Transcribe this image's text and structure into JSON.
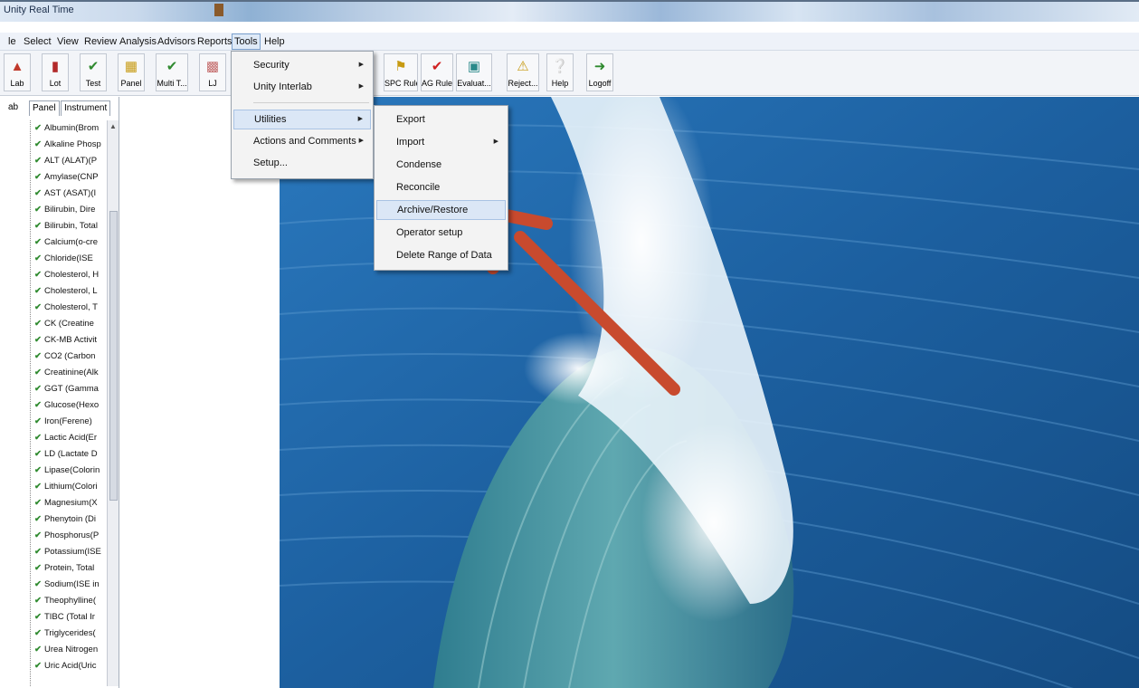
{
  "window": {
    "title": "Unity Real Time"
  },
  "menubar": [
    "le",
    "Select",
    "View",
    "Review",
    "Analysis",
    "Advisors",
    "Reports",
    "Tools",
    "Help"
  ],
  "toolbar": {
    "left": [
      "Lab",
      "Lot",
      "Test",
      "Panel",
      "Multi T...",
      "LJ"
    ],
    "right": [
      "SPC Rules",
      "AG Rules",
      "Evaluat...",
      "Reject...",
      "Help",
      "Logoff"
    ]
  },
  "tree": {
    "tabs": [
      "ab",
      "Panel",
      "Instrument"
    ],
    "items": [
      "Albumin(Brom",
      "Alkaline Phosp",
      "ALT (ALAT)(P",
      "Amylase(CNP",
      "AST (ASAT)(I",
      "Bilirubin, Dire",
      "Bilirubin, Total",
      "Calcium(o-cre",
      "Chloride(ISE ",
      "Cholesterol, H",
      "Cholesterol, L",
      "Cholesterol, T",
      "CK (Creatine",
      "CK-MB Activit",
      "CO2 (Carbon",
      "Creatinine(Alk",
      "GGT (Gamma",
      "Glucose(Hexo",
      "Iron(Ferene)",
      "Lactic Acid(Er",
      "LD (Lactate D",
      "Lipase(Colorin",
      "Lithium(Colori",
      "Magnesium(X",
      "Phenytoin (Di",
      "Phosphorus(P",
      "Potassium(ISE",
      "Protein, Total",
      "Sodium(ISE in",
      "Theophylline(",
      "TIBC (Total Ir",
      "Triglycerides(",
      "Urea Nitrogen",
      "Uric Acid(Uric"
    ]
  },
  "tools_menu": {
    "items": [
      {
        "label": "Security",
        "submenu": true
      },
      {
        "label": "Unity Interlab",
        "submenu": true
      },
      {
        "label": "Utilities",
        "submenu": true
      },
      {
        "label": "Actions and Comments",
        "submenu": true
      },
      {
        "label": "Setup...",
        "submenu": false
      }
    ]
  },
  "utilities_menu": {
    "items": [
      {
        "label": "Export",
        "submenu": false
      },
      {
        "label": "Import",
        "submenu": true
      },
      {
        "label": "Condense",
        "submenu": false
      },
      {
        "label": "Reconcile",
        "submenu": false
      },
      {
        "label": "Archive/Restore",
        "submenu": false
      },
      {
        "label": "Operator setup",
        "submenu": false
      },
      {
        "label": "Delete Range of Data",
        "submenu": false
      }
    ]
  },
  "icons": {
    "submenu_arrow": "triangle-right-icon",
    "tree_item": "analyte-check-icon",
    "annotation": "red-arrow-annotation"
  },
  "colors": {
    "annotation_arrow": "#c84a2e",
    "menu_highlight": "#dbe7f6",
    "tree_glyph": "#2f8a2f"
  }
}
